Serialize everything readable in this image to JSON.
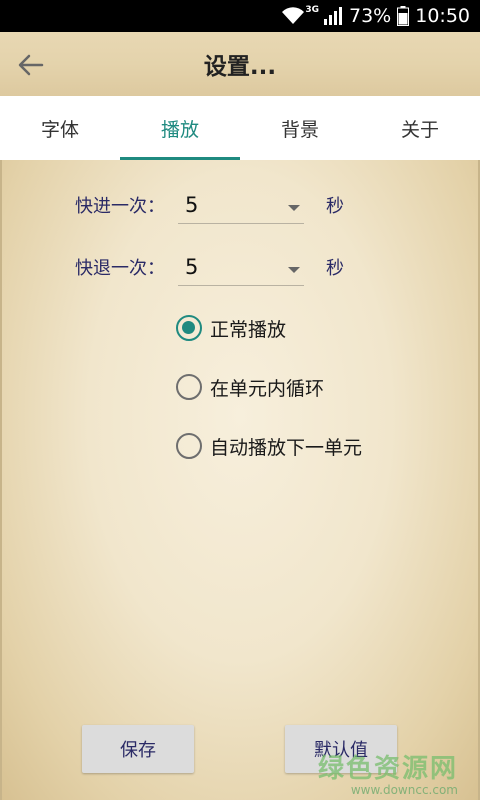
{
  "status_bar": {
    "network": "3G",
    "battery": "73%",
    "time": "10:50"
  },
  "header": {
    "title": "设置..."
  },
  "tabs": [
    {
      "label": "字体",
      "active": false
    },
    {
      "label": "播放",
      "active": true
    },
    {
      "label": "背景",
      "active": false
    },
    {
      "label": "关于",
      "active": false
    }
  ],
  "settings": {
    "fast_forward": {
      "label": "快进一次：",
      "value": "5",
      "unit": "秒"
    },
    "rewind": {
      "label": "快退一次：",
      "value": "5",
      "unit": "秒"
    },
    "play_modes": [
      {
        "label": "正常播放",
        "checked": true
      },
      {
        "label": "在单元内循环",
        "checked": false
      },
      {
        "label": "自动播放下一单元",
        "checked": false
      }
    ]
  },
  "buttons": {
    "save": "保存",
    "default": "默认值"
  },
  "watermark": {
    "name": "绿色资源网",
    "url": "www.downcc.com"
  },
  "colors": {
    "accent": "#1f8a80",
    "label_text": "#2a2a66"
  }
}
